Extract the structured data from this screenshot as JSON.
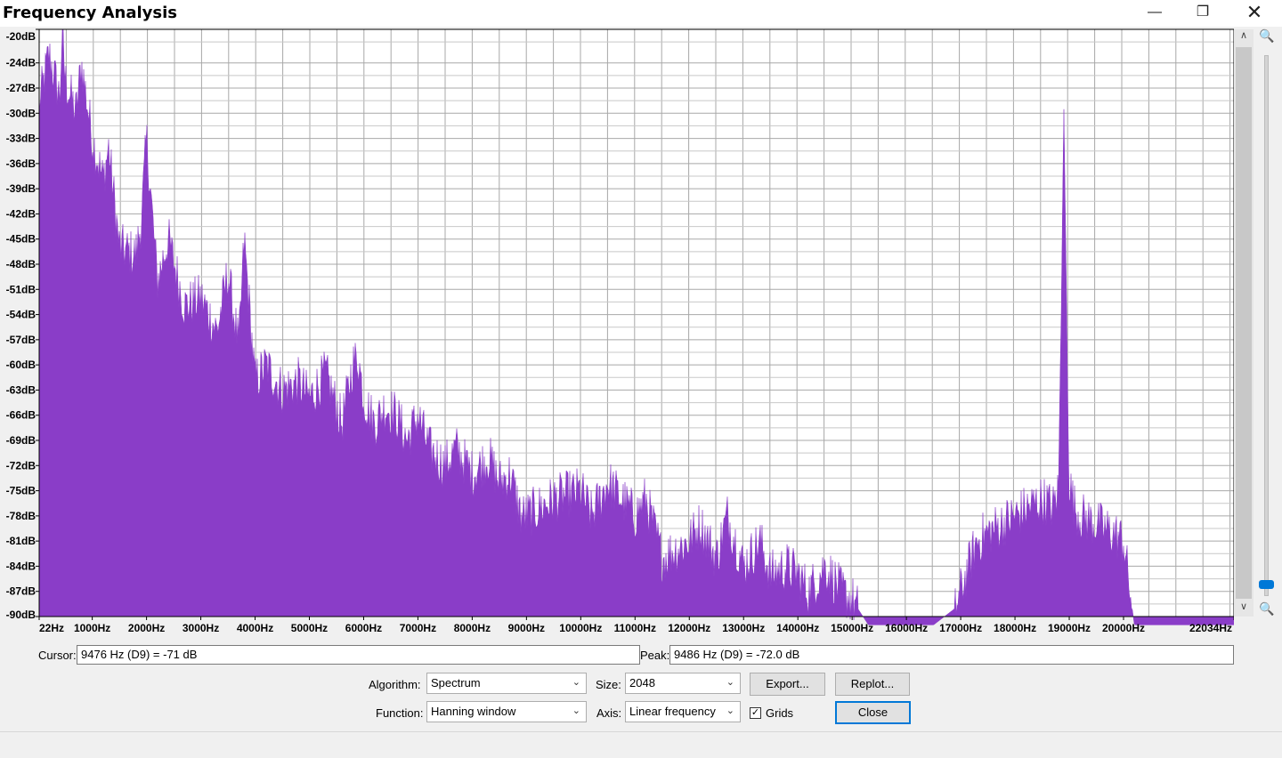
{
  "window": {
    "title": "Frequency Analysis",
    "minimize_icon": "—",
    "maximize_icon": "❐",
    "close_icon": "✕"
  },
  "chart_data": {
    "type": "area",
    "xlabel": "",
    "ylabel": "",
    "xlim": [
      22,
      22034
    ],
    "ylim": [
      -90,
      -20
    ],
    "grid": true,
    "fill_color": "#8a3dc8",
    "x_tick_labels": [
      "22Hz",
      "1000Hz",
      "2000Hz",
      "3000Hz",
      "4000Hz",
      "5000Hz",
      "6000Hz",
      "7000Hz",
      "8000Hz",
      "9000Hz",
      "10000Hz",
      "11000Hz",
      "12000Hz",
      "13000Hz",
      "14000Hz",
      "15000Hz",
      "16000Hz",
      "17000Hz",
      "18000Hz",
      "19000Hz",
      "20000Hz",
      "22034Hz"
    ],
    "y_tick_labels": [
      "-20dB",
      "-24dB",
      "-27dB",
      "-30dB",
      "-33dB",
      "-36dB",
      "-39dB",
      "-42dB",
      "-45dB",
      "-48dB",
      "-51dB",
      "-54dB",
      "-57dB",
      "-60dB",
      "-63dB",
      "-66dB",
      "-69dB",
      "-72dB",
      "-75dB",
      "-78dB",
      "-81dB",
      "-84dB",
      "-87dB",
      "-90dB"
    ],
    "series": [
      {
        "x": [
          22,
          200,
          400,
          450,
          500,
          700,
          800,
          1000,
          1200,
          1300,
          1500,
          1800,
          1900,
          2000,
          2200,
          2400,
          2700,
          3000,
          3300,
          3500,
          3700,
          3800,
          4000,
          4200,
          4500,
          4800,
          5000,
          5300,
          5600,
          5800,
          5900,
          6000,
          6200,
          6400,
          6600,
          6800,
          7000,
          7200,
          7500,
          7700,
          8000,
          8300,
          8500,
          8700,
          8900,
          9000,
          9500,
          10000,
          10200,
          10500,
          11000,
          11200,
          11500,
          12000,
          12200,
          12500,
          12700,
          13000,
          13300,
          13500,
          13800,
          14000,
          14200,
          14500,
          14800,
          15000,
          15200,
          15300,
          15500,
          16000,
          16500,
          16700,
          16900,
          17000,
          17300,
          17500,
          18000,
          18500,
          18700,
          18800,
          18850,
          18900,
          18950,
          19000,
          19100,
          19200,
          19500,
          19800,
          20000,
          20100,
          20200,
          20500,
          21000,
          22034
        ],
        "y": [
          -29,
          -23,
          -28,
          -20,
          -26,
          -30,
          -24,
          -33,
          -38,
          -34,
          -46,
          -47,
          -43,
          -33,
          -50,
          -45,
          -53,
          -52,
          -56,
          -49,
          -58,
          -45,
          -62,
          -60,
          -63,
          -62,
          -64,
          -61,
          -67,
          -60,
          -59,
          -64,
          -67,
          -65,
          -66,
          -69,
          -66,
          -70,
          -72,
          -70,
          -73,
          -71,
          -74,
          -73,
          -78,
          -78,
          -76,
          -75,
          -78,
          -74,
          -78,
          -76,
          -83,
          -81,
          -79,
          -83,
          -78,
          -84,
          -81,
          -85,
          -84,
          -85,
          -87,
          -84,
          -87,
          -88,
          -90,
          -91,
          -91,
          -91,
          -91,
          -90,
          -89,
          -87,
          -81,
          -80,
          -78,
          -76,
          -77,
          -75,
          -55,
          -29,
          -52,
          -74,
          -77,
          -78,
          -79,
          -80,
          -81,
          -86,
          -91,
          -91,
          -91,
          -91
        ]
      }
    ],
    "background_noise": "true"
  },
  "controls": {
    "cursor_label": "Cursor:",
    "cursor_value": "9476 Hz (D9) = -71 dB",
    "peak_label": "Peak:",
    "peak_value": "9486 Hz (D9) = -72.0 dB",
    "algorithm_label": "Algorithm:",
    "algorithm_value": "Spectrum",
    "size_label": "Size:",
    "size_value": "2048",
    "function_label": "Function:",
    "function_value": "Hanning window",
    "axis_label": "Axis:",
    "axis_value": "Linear frequency",
    "grids_label": "Grids",
    "grids_checked": "✓",
    "export_label": "Export...",
    "replot_label": "Replot...",
    "close_label": "Close",
    "dropdown_icon": "⌄",
    "scroll_up_icon": "∧",
    "scroll_down_icon": "∨",
    "zoom_in_icon": "🔍",
    "zoom_out_icon": "🔍"
  }
}
